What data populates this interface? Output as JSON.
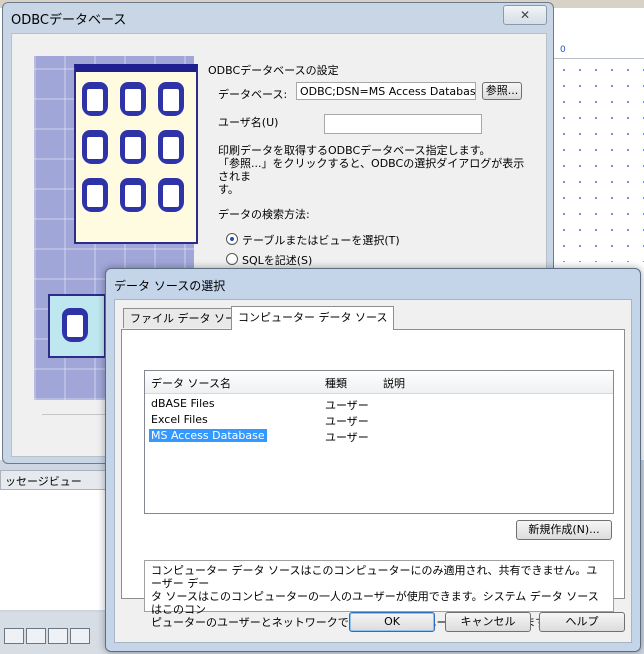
{
  "background": {
    "ruler_mark": "0",
    "message_tab": "ッセージビュー"
  },
  "odbc_dialog": {
    "title": "ODBCデータベース",
    "close_symbol": "✕",
    "section_title": "ODBCデータベースの設定",
    "database_label": "データベース:",
    "database_value": "ODBC;DSN=MS Access Database;I",
    "browse_button": "参照...",
    "username_label": "ユーザ名(U)",
    "username_value": "",
    "description_line1": "印刷データを取得するODBCデータベース指定します。",
    "description_line2": "「参照...」をクリックすると、ODBCの選択ダイアログが表示されま",
    "description_line3": "す。",
    "search_method_label": "データの検索方法:",
    "radio_table": "テーブルまたはビューを選択(T)",
    "radio_sql": "SQLを記述(S)"
  },
  "dsn_dialog": {
    "title": "データ ソースの選択",
    "tabs": [
      {
        "label": "ファイル データ ソース",
        "active": false
      },
      {
        "label": "コンピューター データ ソース",
        "active": true
      }
    ],
    "columns": {
      "name": "データ ソース名",
      "type": "種類",
      "description": "説明"
    },
    "rows": [
      {
        "name": "dBASE Files",
        "type": "ユーザー",
        "description": ""
      },
      {
        "name": "Excel Files",
        "type": "ユーザー",
        "description": ""
      },
      {
        "name": "MS Access Database",
        "type": "ユーザー",
        "description": ""
      }
    ],
    "selected_row": 2,
    "new_button": "新規作成(N)...",
    "info_line1": "コンピューター データ ソースはこのコンピューターにのみ適用され、共有できません。ユーザー デー",
    "info_line2": "タ ソースはこのコンピューターの一人のユーザーが使用できます。システム データ ソースはこのコン",
    "info_line3": "ピューターのユーザーとネットワークで接続されているユーザーが使用できます。",
    "ok_button": "OK",
    "cancel_button": "キャンセル",
    "help_button": "ヘルプ"
  },
  "colors": {
    "selection": "#3399ff",
    "dialog_frame": "#c4d5ea"
  }
}
